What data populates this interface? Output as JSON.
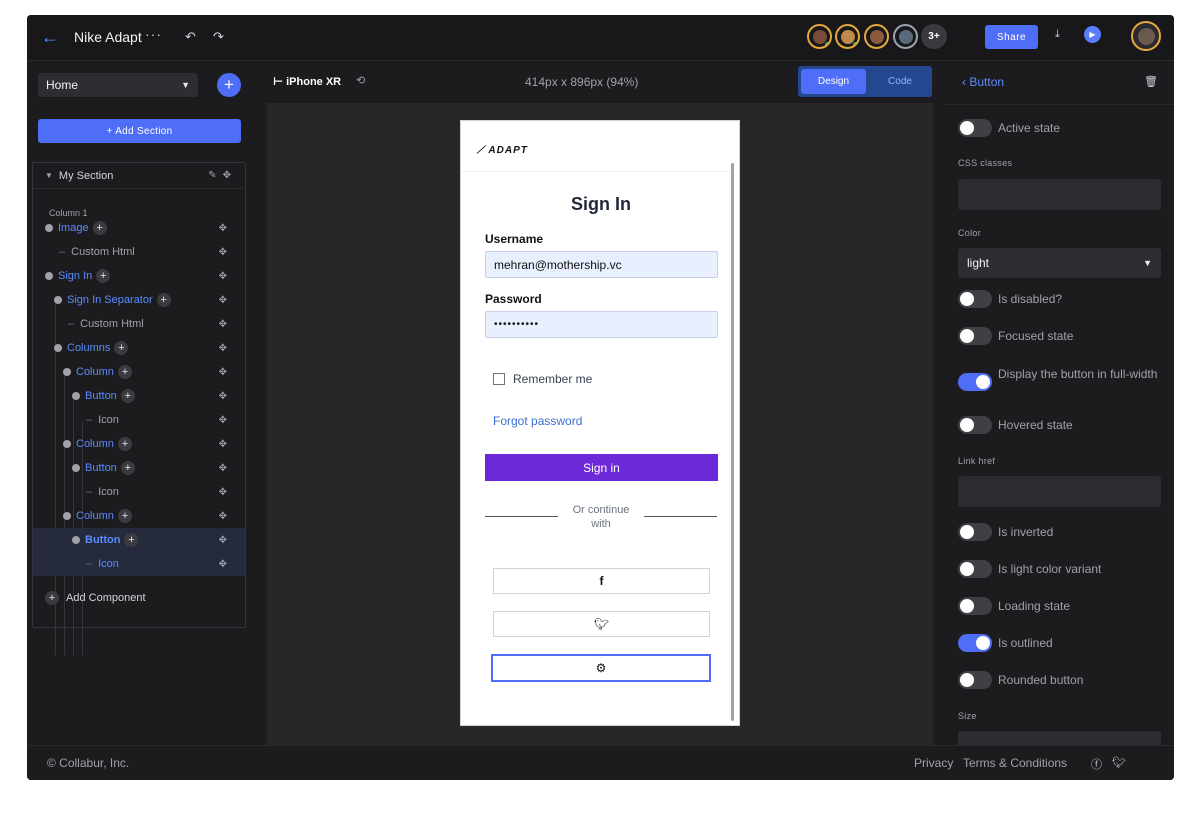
{
  "topbar": {
    "project_name": "Nike Adapt",
    "more_icon": "ellipsis-icon",
    "undo_icon": "undo-icon",
    "redo_icon": "redo-icon",
    "collaborator_extra": "3+",
    "share_label": "Share",
    "download_icon": "download-icon",
    "preview_icon": "play-icon"
  },
  "sidebar": {
    "page_select": "Home",
    "add_section_label": "+ Add Section",
    "section_title": "My Section",
    "column_label": "Column 1",
    "tree": [
      {
        "label": "Image",
        "kind": "node",
        "plus": true
      },
      {
        "label": "Custom Html",
        "kind": "leaf"
      },
      {
        "label": "Sign In",
        "kind": "node",
        "plus": true
      },
      {
        "label": "Sign In Separator",
        "kind": "node",
        "plus": true
      },
      {
        "label": "Custom Html",
        "kind": "leaf"
      },
      {
        "label": "Columns",
        "kind": "node",
        "plus": true
      },
      {
        "label": "Column",
        "kind": "node",
        "plus": true
      },
      {
        "label": "Button",
        "kind": "node",
        "plus": true
      },
      {
        "label": "Icon",
        "kind": "leaf"
      },
      {
        "label": "Column",
        "kind": "node",
        "plus": true
      },
      {
        "label": "Button",
        "kind": "node",
        "plus": true
      },
      {
        "label": "Icon",
        "kind": "leaf"
      },
      {
        "label": "Column",
        "kind": "node",
        "plus": true
      },
      {
        "label": "Button",
        "kind": "node",
        "plus": true,
        "selected": true
      },
      {
        "label": "Icon",
        "kind": "leaf",
        "selected": true
      }
    ],
    "add_component_label": "Add Component"
  },
  "toolbar": {
    "device": "⊢ iPhone XR",
    "dimensions": "414px x 896px (94%)",
    "mode_design": "Design",
    "mode_code": "Code"
  },
  "preview": {
    "logo_text": "ADAPT",
    "title": "Sign In",
    "username_label": "Username",
    "username_value": "mehran@mothership.vc",
    "password_label": "Password",
    "password_value": "••••••••••",
    "remember_label": "Remember me",
    "forgot_label": "Forgot password",
    "signin_button": "Sign in",
    "separator_text": "Or continue with",
    "social": [
      "facebook-icon",
      "twitter-icon",
      "github-icon"
    ]
  },
  "rightpanel": {
    "title": "Button",
    "props": {
      "active_state": "Active state",
      "css_classes": "CSS classes",
      "color_label": "Color",
      "color_value": "light",
      "is_disabled": "Is disabled?",
      "focused_state": "Focused state",
      "full_width": "Display the button in full-width",
      "hovered_state": "Hovered state",
      "link_href": "Link href",
      "is_inverted": "Is inverted",
      "is_light": "Is light color variant",
      "loading_state": "Loading state",
      "is_outlined": "Is outlined",
      "rounded": "Rounded button",
      "size_label": "Size"
    },
    "toggles": {
      "active_state": false,
      "is_disabled": false,
      "focused_state": false,
      "full_width": true,
      "hovered_state": false,
      "is_inverted": false,
      "is_light": false,
      "loading_state": false,
      "is_outlined": true,
      "rounded": false
    }
  },
  "footer": {
    "copyright": "© Collabur, Inc.",
    "privacy": "Privacy",
    "terms": "Terms & Conditions"
  },
  "colors": {
    "accent": "#4f6ef7",
    "signin_button": "#6d28d9",
    "background": "#1c1c1e"
  }
}
